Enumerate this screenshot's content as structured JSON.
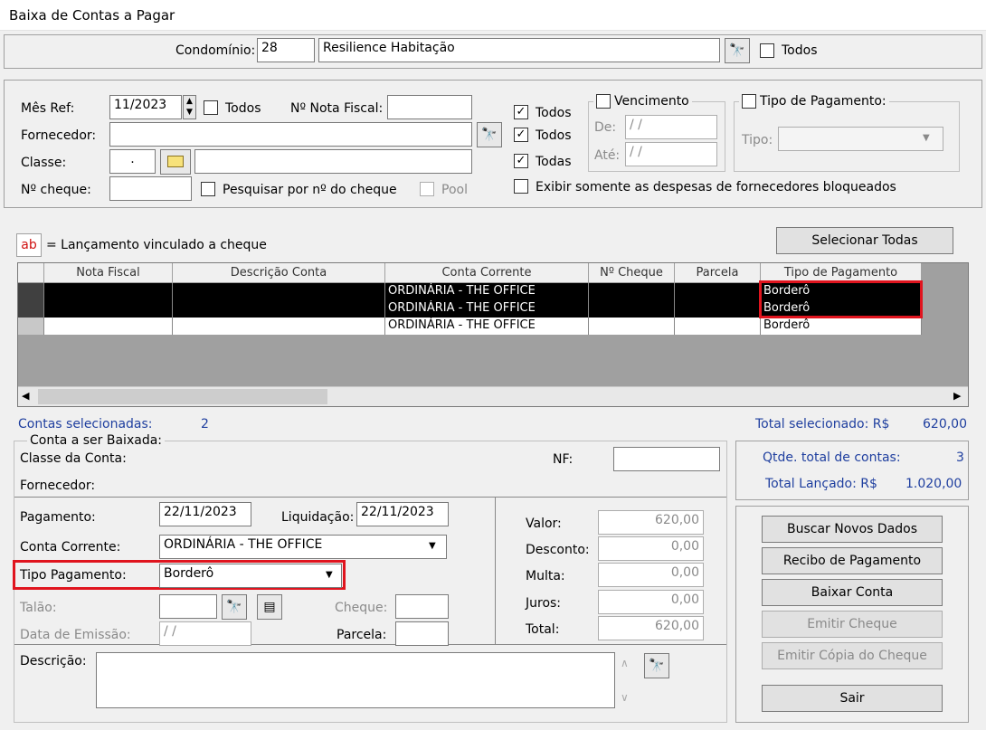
{
  "window": {
    "title": "Baixa de Contas a Pagar"
  },
  "header": {
    "condominio_label": "Condomínio:",
    "condominio_code": "28",
    "condominio_name": "Resilience Habitação",
    "todos_label": "Todos"
  },
  "filters": {
    "mes_ref_label": "Mês Ref:",
    "mes_ref_value": "11/2023",
    "todos_mes_label": "Todos",
    "nota_fiscal_label": "Nº Nota Fiscal:",
    "nota_fiscal_value": "",
    "fornecedor_label": "Fornecedor:",
    "fornecedor_value": "",
    "classe_label": "Classe:",
    "classe_value": ".",
    "classe_desc": "",
    "cheque_label": "Nº cheque:",
    "cheque_value": "",
    "pesquisar_cheque_label": "Pesquisar por nº do cheque",
    "pool_label": "Pool",
    "todos1_label": "Todos",
    "todos2_label": "Todos",
    "todas_label": "Todas",
    "exibir_bloqueados_label": "Exibir somente as despesas de fornecedores bloqueados",
    "vencimento_label": "Vencimento",
    "de_label": "De:",
    "de_value": "/ /",
    "ate_label": "Até:",
    "ate_value": "/ /",
    "tipo_pagamento_label": "Tipo de Pagamento:",
    "tipo_label": "Tipo:",
    "tipo_value": ""
  },
  "legend": {
    "icon_text": "ab",
    "text": "= Lançamento vinculado a cheque"
  },
  "selecionar_todas": "Selecionar Todas",
  "table": {
    "columns": [
      "Nota Fiscal",
      "Descrição Conta",
      "Conta Corrente",
      "Nº Cheque",
      "Parcela",
      "Tipo de Pagamento"
    ],
    "rows": [
      {
        "nota": "",
        "desc": "",
        "conta": "ORDINÁRIA - THE OFFICE",
        "cheque": "",
        "parcela": "",
        "tipo": "Borderô"
      },
      {
        "nota": "",
        "desc": "",
        "conta": "ORDINÁRIA - THE OFFICE",
        "cheque": "",
        "parcela": "",
        "tipo": "Borderô"
      },
      {
        "nota": "",
        "desc": "",
        "conta": "ORDINÁRIA - THE OFFICE",
        "cheque": "",
        "parcela": "",
        "tipo": "Borderô"
      }
    ]
  },
  "summary": {
    "contas_selecionadas_label": "Contas selecionadas:",
    "contas_selecionadas_value": "2",
    "total_selecionado_label": "Total selecionado: R$",
    "total_selecionado_value": "620,00",
    "qtde_label": "Qtde. total de contas:",
    "qtde_value": "3",
    "total_lancado_label": "Total Lançado: R$",
    "total_lancado_value": "1.020,00"
  },
  "detail": {
    "group_title": "Conta a ser Baixada:",
    "classe_label": "Classe da Conta:",
    "nf_label": "NF:",
    "nf_value": "",
    "fornecedor_label": "Fornecedor:",
    "pagamento_label": "Pagamento:",
    "pagamento_value": "22/11/2023",
    "liquidacao_label": "Liquidação:",
    "liquidacao_value": "22/11/2023",
    "conta_corrente_label": "Conta Corrente:",
    "conta_corrente_value": "ORDINÁRIA - THE OFFICE",
    "tipo_pagamento_label": "Tipo Pagamento:",
    "tipo_pagamento_value": "Borderô",
    "talao_label": "Talão:",
    "cheque_label": "Cheque:",
    "data_emissao_label": "Data de Emissão:",
    "data_emissao_value": "/ /",
    "parcela_label": "Parcela:",
    "descricao_label": "Descrição:",
    "valor_label": "Valor:",
    "valor_value": "620,00",
    "desconto_label": "Desconto:",
    "desconto_value": "0,00",
    "multa_label": "Multa:",
    "multa_value": "0,00",
    "juros_label": "Juros:",
    "juros_value": "0,00",
    "total_label": "Total:",
    "total_value": "620,00"
  },
  "actions": {
    "buscar": "Buscar Novos Dados",
    "recibo": "Recibo de Pagamento",
    "baixar": "Baixar Conta",
    "emitir_cheque": "Emitir Cheque",
    "emitir_copia": "Emitir Cópia do Cheque",
    "sair": "Sair"
  }
}
